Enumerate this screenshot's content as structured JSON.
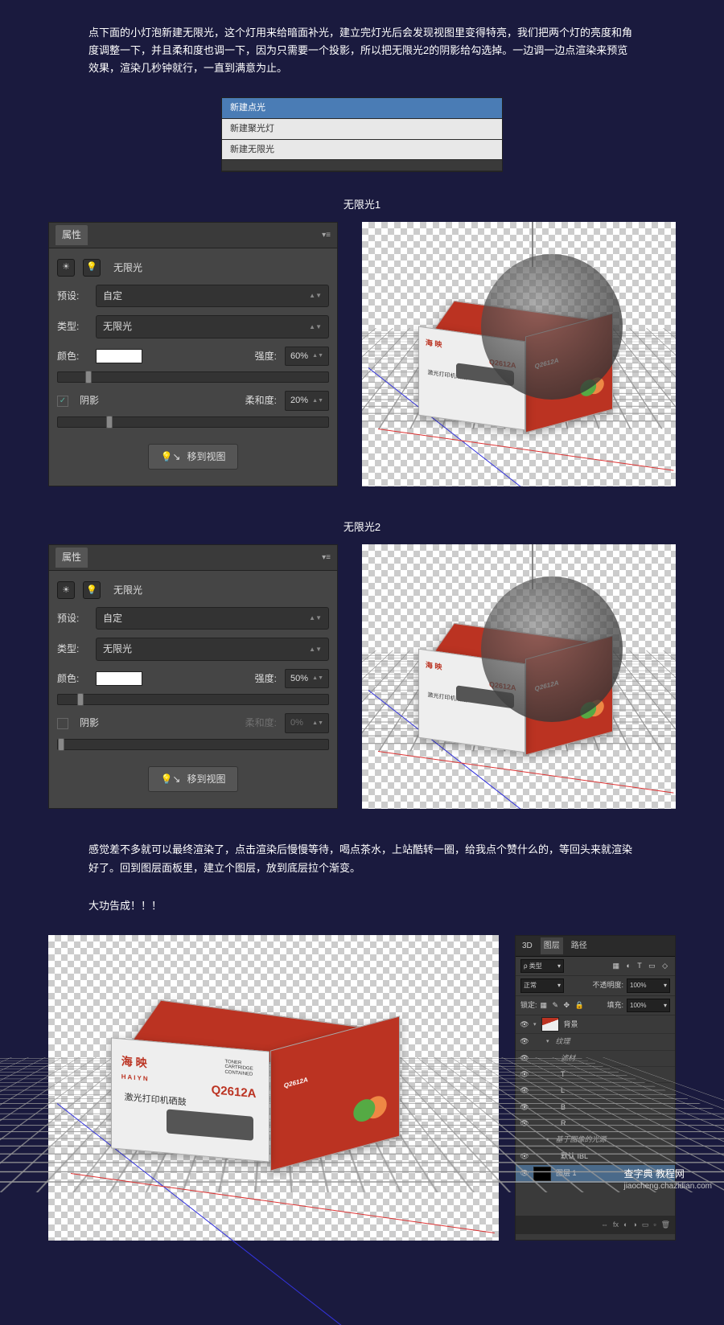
{
  "intro": {
    "p1": "点下面的小灯泡新建无限光，这个灯用来给暗面补光，建立完灯光后会发现视图里变得特亮，我们把两个灯的亮度和角度调整一下，并且柔和度也调一下，因为只需要一个投影，所以把无限光2的阴影给勾选掉。一边调一边点渲染来预览效果，渲染几秒钟就行，一直到满意为止。"
  },
  "menu": {
    "i1": "新建点光",
    "i2": "新建聚光灯",
    "i3": "新建无限光"
  },
  "labels": {
    "light1": "无限光1",
    "light2": "无限光2"
  },
  "panel": {
    "tab": "属性",
    "title": "无限光",
    "preset_lab": "预设:",
    "preset_val": "自定",
    "type_lab": "类型:",
    "type_val": "无限光",
    "color_lab": "颜色:",
    "intensity_lab": "强度:",
    "shadow_lab": "阴影",
    "soft_lab": "柔和度:",
    "btn": "移到视图"
  },
  "light1": {
    "intensity": "60%",
    "shadow_checked": "✓",
    "soft": "20%"
  },
  "light2": {
    "intensity": "50%",
    "shadow_checked": "",
    "soft": "0%"
  },
  "product": {
    "brand": "海 映",
    "brand_en": "HAIYN",
    "model": "Q2612A",
    "desc": "激光打印机硒鼓",
    "toner": "TONER CARTRIDGE\nCONTAINED"
  },
  "outro": {
    "p1": "感觉差不多就可以最终渲染了，点击渲染后慢慢等待，喝点茶水，上站酷转一圈，给我点个赞什么的，等回头来就渲染好了。回到图层面板里，建立个图层，放到底层拉个渐变。",
    "p2": "大功告成！！！"
  },
  "layers": {
    "tab_3d": "3D",
    "tab_layers": "图层",
    "tab_paths": "路径",
    "kind": "ρ 类型",
    "mode": "正常",
    "opacity_lab": "不透明度:",
    "opacity": "100%",
    "lock_lab": "锁定:",
    "fill_lab": "填充:",
    "fill": "100%",
    "l_bg": "背景",
    "l_tex": "纹理",
    "l_filter": "滤材",
    "l_t": "T",
    "l_l": "L",
    "l_b": "B",
    "l_r": "R",
    "l_ibl_group": "基于图像的光源",
    "l_ibl": "默认 IBL",
    "l_new": "图层 1",
    "fx": "fx"
  },
  "watermark": {
    "site": "查字典 教程网",
    "domain": "jiaocheng.chazidian.com"
  }
}
